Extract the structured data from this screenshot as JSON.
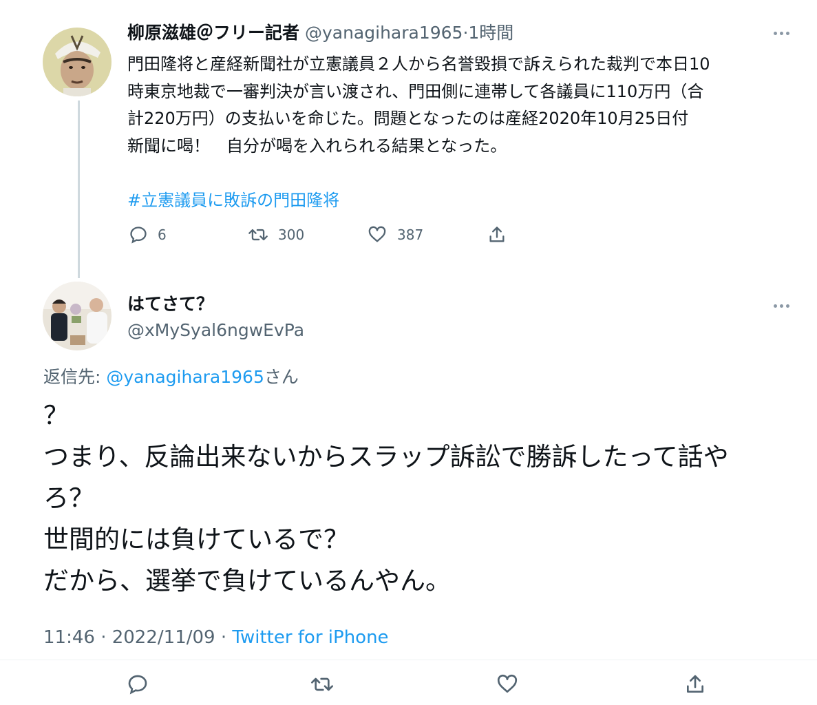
{
  "tweet1": {
    "author_name": "柳原滋雄＠フリー記者",
    "author_handle": "@yanagihara1965",
    "separator": "·",
    "time": "1時間",
    "body": "門田隆将と産経新聞社が立憲議員２人から名誉毀損で訴えられた裁判で本日10\n時東京地裁で一審判決が言い渡され、門田側に連帯して各議員に110万円（合\n計220万円）の支払いを命じた。問題となったのは産経2020年10月25日付\n新聞に喝！　自分が喝を入れられる結果となった。",
    "hashtag": "#立憲議員に敗訴の門田隆将",
    "replies": "6",
    "retweets": "300",
    "likes": "387"
  },
  "tweet2": {
    "author_name": "はてさて？",
    "author_handle": "@xMySyal6ngwEvPa",
    "reply_label": "返信先:",
    "reply_handle": "@yanagihara1965",
    "reply_suffix": "さん",
    "body": "？\nつまり、反論出来ないからスラップ訴訟で勝訴したって話や\nろ？\n世間的には負けているで？\nだから、選挙で負けているんやん。",
    "timestamp": "11:46 · 2022/11/09 · ",
    "source": "Twitter for iPhone"
  },
  "icons": {
    "reply": "reply-icon",
    "retweet": "retweet-icon",
    "like": "heart-icon",
    "share": "share-icon",
    "more": "more-icon"
  },
  "colors": {
    "accent": "#1d9bf0",
    "muted": "#536471",
    "icon": "#536471"
  }
}
